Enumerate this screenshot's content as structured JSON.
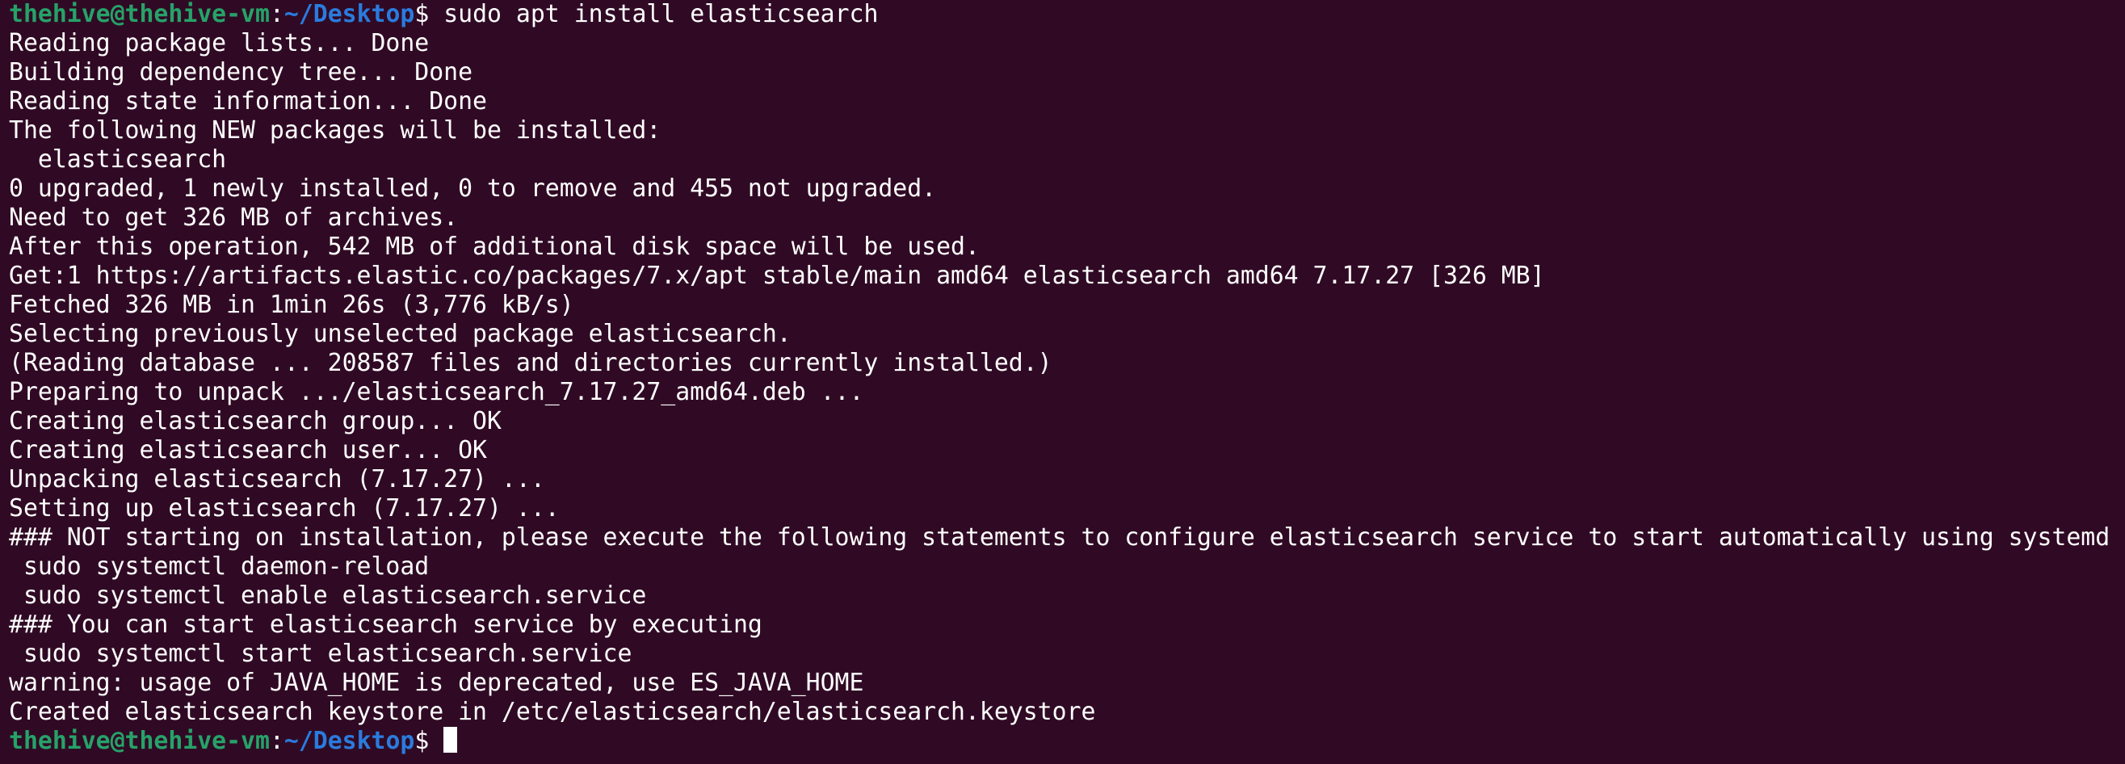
{
  "prompt": {
    "user_host": "thehive@thehive-vm",
    "colon": ":",
    "path": "~/Desktop",
    "dollar": "$"
  },
  "command": " sudo apt install elasticsearch",
  "output": [
    "Reading package lists... Done",
    "Building dependency tree... Done",
    "Reading state information... Done",
    "The following NEW packages will be installed:",
    "  elasticsearch",
    "0 upgraded, 1 newly installed, 0 to remove and 455 not upgraded.",
    "Need to get 326 MB of archives.",
    "After this operation, 542 MB of additional disk space will be used.",
    "Get:1 https://artifacts.elastic.co/packages/7.x/apt stable/main amd64 elasticsearch amd64 7.17.27 [326 MB]",
    "Fetched 326 MB in 1min 26s (3,776 kB/s)",
    "Selecting previously unselected package elasticsearch.",
    "(Reading database ... 208587 files and directories currently installed.)",
    "Preparing to unpack .../elasticsearch_7.17.27_amd64.deb ...",
    "Creating elasticsearch group... OK",
    "Creating elasticsearch user... OK",
    "Unpacking elasticsearch (7.17.27) ...",
    "Setting up elasticsearch (7.17.27) ...",
    "### NOT starting on installation, please execute the following statements to configure elasticsearch service to start automatically using systemd",
    " sudo systemctl daemon-reload",
    " sudo systemctl enable elasticsearch.service",
    "### You can start elasticsearch service by executing",
    " sudo systemctl start elasticsearch.service",
    "warning: usage of JAVA_HOME is deprecated, use ES_JAVA_HOME",
    "Created elasticsearch keystore in /etc/elasticsearch/elasticsearch.keystore"
  ],
  "colors": {
    "background": "#300a24",
    "prompt_user": "#26a269",
    "prompt_path": "#2a7bde",
    "text": "#ffffff"
  }
}
